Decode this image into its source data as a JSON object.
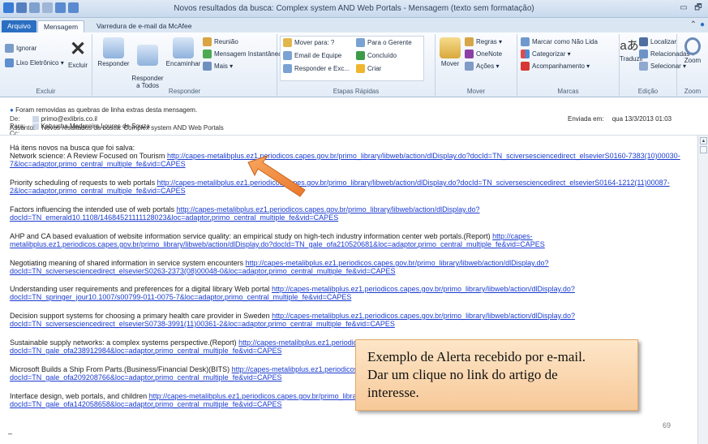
{
  "window": {
    "title": "Novos resultados da busca: Complex system AND Web Portals  -  Mensagem (texto sem formatação)",
    "minimize": "▭",
    "restore": "🗗",
    "close": "✕"
  },
  "tabs": {
    "file": "Arquivo",
    "message": "Mensagem",
    "mcafee": "Varredura de e-mail da McAfee"
  },
  "ribbon": {
    "excluir": {
      "ignore": "Ignorar",
      "junk": "Lixo Eletrônico ▾",
      "delete": "Excluir",
      "label": "Excluir"
    },
    "responder": {
      "reply": "Responder",
      "reply_all": "Responder\na Todos",
      "forward": "Encaminhar",
      "meeting": "Reunião",
      "im": "Mensagem Instantânea ▾",
      "more": "Mais ▾",
      "label": "Responder"
    },
    "etapas": {
      "move_to": "Mover para: ?",
      "to_manager": "Para o Gerente",
      "team_email": "Email de Equipe",
      "done": "Concluído",
      "reply_delete": "Responder e Exc...",
      "create": "Criar",
      "label": "Etapas Rápidas"
    },
    "mover": {
      "move": "Mover",
      "rules": "Regras ▾",
      "onenote": "OneNote",
      "actions": "Ações ▾",
      "label": "Mover"
    },
    "marcas": {
      "mark_unread": "Marcar como Não Lida",
      "categorize": "Categorizar ▾",
      "follow_up": "Acompanhamento ▾",
      "label": "Marcas"
    },
    "edicao": {
      "translate": "Traduzir",
      "find": "Localizar",
      "related": "Relacionadas ▾",
      "select": "Selecionar ▾",
      "label": "Edição"
    },
    "zoom": {
      "zoom": "Zoom",
      "label": "Zoom"
    }
  },
  "header": {
    "notice": "Foram removidas as quebras de linha extras desta mensagem.",
    "from_label": "De:",
    "from": "primo@exlibris.co.il",
    "to_label": "Para:",
    "to": "Katyusha Madureira Loures de Souza",
    "cc_label": "Cc:",
    "subject_label": "Assunto:",
    "subject": "Novos resultados da busca: Complex system AND Web Portals",
    "sent_label": "Enviada em:",
    "sent": "qua 13/3/2013 01:03"
  },
  "body": {
    "intro": "Há itens novos na busca que foi salva:",
    "items": [
      {
        "title": "Network science: A Review Focused on Tourism",
        "link": "http://capes-metalibplus.ez1.periodicos.capes.gov.br/primo_library/libweb/action/dlDisplay.do?docId=TN_sciversesciencedirect_elsevierS0160-7383(10)00030-7&loc=adaptor,primo_central_multiple_fe&vid=CAPES"
      },
      {
        "title": "Priority scheduling of requests to web portals",
        "link": "http://capes-metalibplus.ez1.periodicos.capes.gov.br/primo_library/libweb/action/dlDisplay.do?docId=TN_sciversesciencedirect_elsevierS0164-1212(11)00087-2&loc=adaptor,primo_central_multiple_fe&vid=CAPES"
      },
      {
        "title": "Factors influencing the intended use of web portals",
        "link": "http://capes-metalibplus.ez1.periodicos.capes.gov.br/primo_library/libweb/action/dlDisplay.do?docId=TN_emerald10.1108/14684521111128023&loc=adaptor,primo_central_multiple_fe&vid=CAPES"
      },
      {
        "title": "AHP and CA based evaluation of website information service quality: an empirical study on high-tech industry information center web portals.(Report)",
        "link": "http://capes-metalibplus.ez1.periodicos.capes.gov.br/primo_library/libweb/action/dlDisplay.do?docId=TN_gale_ofa210520681&loc=adaptor,primo_central_multiple_fe&vid=CAPES"
      },
      {
        "title": "Negotiating meaning of shared information in service system encounters",
        "link": "http://capes-metalibplus.ez1.periodicos.capes.gov.br/primo_library/libweb/action/dlDisplay.do?docId=TN_sciversesciencedirect_elsevierS0263-2373(08)00048-0&loc=adaptor,primo_central_multiple_fe&vid=CAPES"
      },
      {
        "title": "Understanding user requirements and preferences for a digital library Web portal",
        "link": "http://capes-metalibplus.ez1.periodicos.capes.gov.br/primo_library/libweb/action/dlDisplay.do?docId=TN_springer_jour10.1007/s00799-011-0075-7&loc=adaptor,primo_central_multiple_fe&vid=CAPES"
      },
      {
        "title": "Decision support systems for choosing a primary health care provider in Sweden",
        "link": "http://capes-metalibplus.ez1.periodicos.capes.gov.br/primo_library/libweb/action/dlDisplay.do?docId=TN_sciversesciencedirect_elsevierS0738-3991(11)00361-2&loc=adaptor,primo_central_multiple_fe&vid=CAPES"
      },
      {
        "title": "Sustainable supply networks: a complex systems perspective.(Report)",
        "link": "http://capes-metalibplus.ez1.periodicos.capes.gov.br/primo_library/libweb/action/dlDisplay.do?docId=TN_gale_ofa238912984&loc=adaptor,primo_central_multiple_fe&vid=CAPES"
      },
      {
        "title": "Microsoft Builds a Ship From Parts.(Business/Financial Desk)(BITS)",
        "link": "http://capes-metalibplus.ez1.periodicos.capes.gov.br/primo_library/libweb/action/dlDisplay.do?docId=TN_gale_ofa209208766&loc=adaptor,primo_central_multiple_fe&vid=CAPES"
      },
      {
        "title": "Interface design, web portals, and children",
        "link": "http://capes-metalibplus.ez1.periodicos.capes.gov.br/primo_library/libweb/action/dlDisplay.do?docId=TN_gale_ofa142058658&loc=adaptor,primo_central_multiple_fe&vid=CAPES"
      }
    ],
    "end_dash": "–"
  },
  "callout": {
    "text": "Exemplo de Alerta recebido por e-mail.\nDar um clique no link do artigo de\ninteresse."
  },
  "page_number": "69",
  "colors": {
    "file_tab": "#2b6fc2",
    "link": "#1b3cd1",
    "callout_fill": "#f7c999",
    "arrow": "#f08a3c"
  }
}
